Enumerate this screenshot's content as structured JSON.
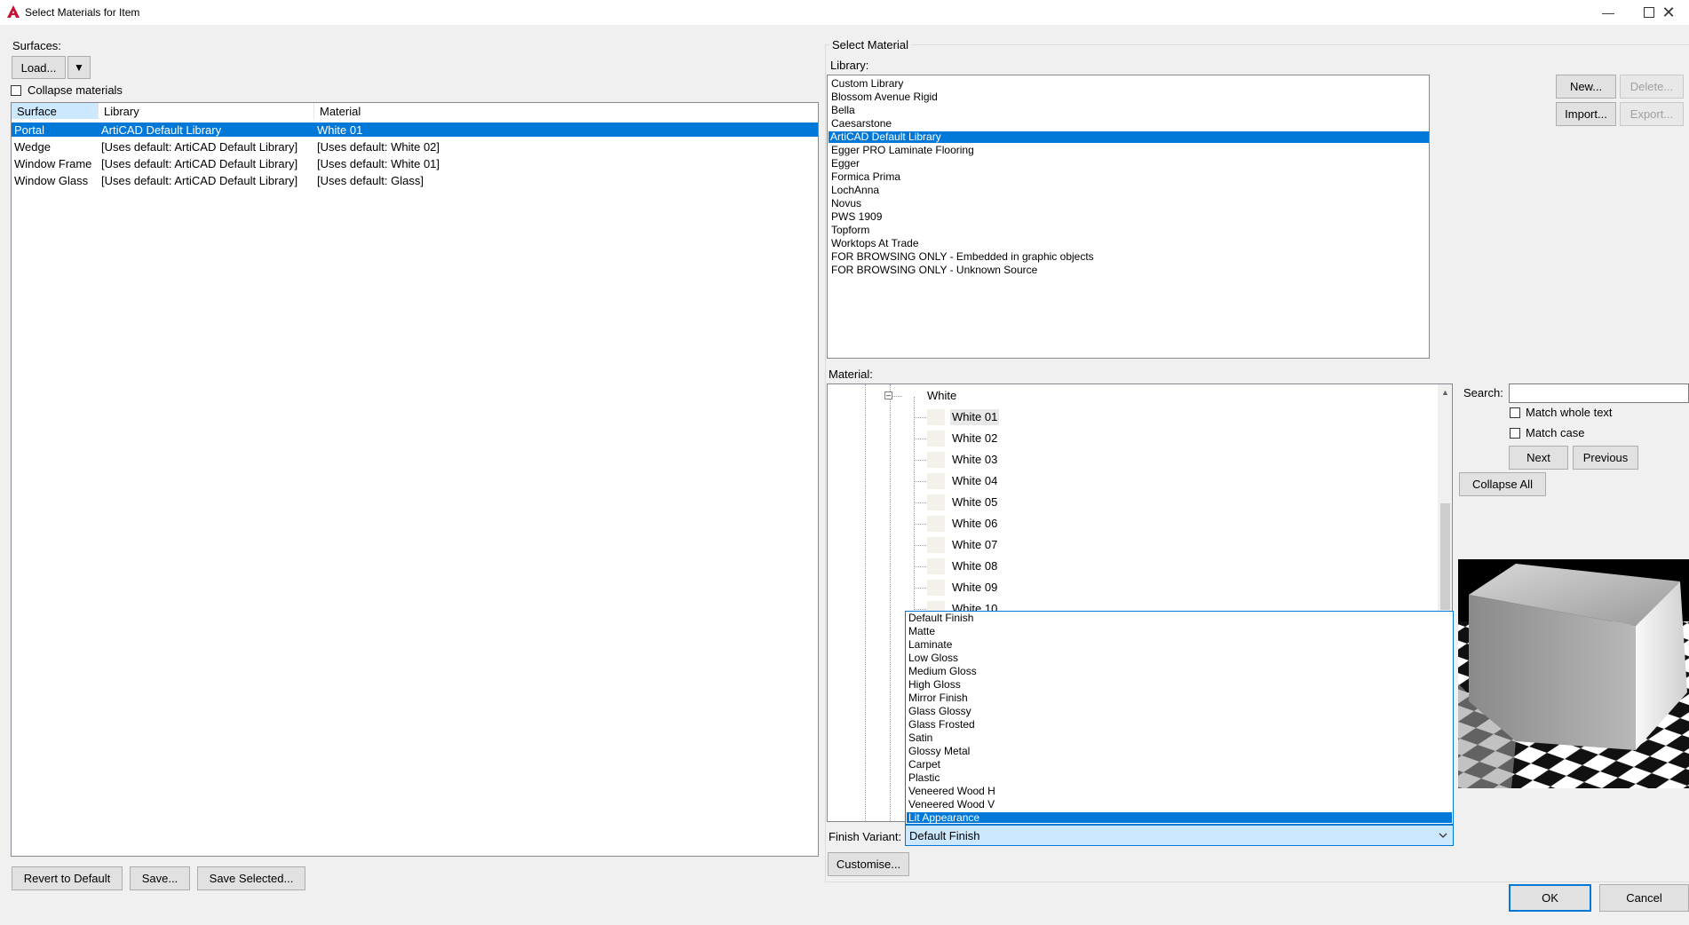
{
  "window": {
    "title": "Select Materials for Item",
    "minimize_icon": "minimize-icon",
    "maximize_icon": "maximize-icon",
    "close_icon": "close-icon"
  },
  "surfaces": {
    "label": "Surfaces:",
    "load_button": "Load...",
    "load_dropdown_glyph": "▼",
    "collapse_label": "Collapse materials",
    "columns": [
      "Surface",
      "Library",
      "Material"
    ],
    "rows": [
      {
        "surface": "Portal",
        "library": "ArtiCAD Default Library",
        "material": "White 01",
        "selected": true
      },
      {
        "surface": "Wedge",
        "library": "[Uses default: ArtiCAD Default Library]",
        "material": "[Uses default: White 02]",
        "selected": false
      },
      {
        "surface": "Window Frame",
        "library": "[Uses default: ArtiCAD Default Library]",
        "material": "[Uses default: White 01]",
        "selected": false
      },
      {
        "surface": "Window Glass",
        "library": "[Uses default: ArtiCAD Default Library]",
        "material": "[Uses default: Glass]",
        "selected": false
      }
    ],
    "revert_button": "Revert to Default",
    "save_button": "Save...",
    "save_selected_button": "Save Selected..."
  },
  "select_material": {
    "group_label": "Select Material",
    "library_label": "Library:",
    "libraries": [
      "Custom Library",
      "Blossom Avenue Rigid",
      "Bella",
      "Caesarstone",
      "ArtiCAD Default Library",
      "Egger PRO Laminate Flooring",
      "Egger",
      "Formica Prima",
      "LochAnna",
      "Novus",
      "PWS 1909",
      "Topform",
      "Worktops At Trade",
      "FOR BROWSING ONLY - Embedded in graphic objects",
      "FOR BROWSING ONLY - Unknown Source"
    ],
    "selected_library": "ArtiCAD Default Library",
    "new_button": "New...",
    "delete_button": "Delete...",
    "import_button": "Import...",
    "export_button": "Export...",
    "material_label": "Material:",
    "tree_group": "White",
    "tree_items": [
      "White 01",
      "White 02",
      "White 03",
      "White 04",
      "White 05",
      "White 06",
      "White 07",
      "White 08",
      "White 09",
      "White 10"
    ],
    "search_label": "Search:",
    "search_value": "",
    "match_whole_text": "Match whole text",
    "match_case": "Match case",
    "next_button": "Next",
    "previous_button": "Previous",
    "collapse_all_button": "Collapse All",
    "finish_variant_label": "Finish Variant:",
    "finish_variant_value": "Default Finish",
    "finish_options": [
      "Default Finish",
      "Matte",
      "Laminate",
      "Low Gloss",
      "Medium Gloss",
      "High Gloss",
      "Mirror Finish",
      "Glass Glossy",
      "Glass Frosted",
      "Satin",
      "Glossy Metal",
      "Carpet",
      "Plastic",
      "Veneered Wood H",
      "Veneered Wood V",
      "Lit Appearance"
    ],
    "highlighted_option": "Lit Appearance",
    "customise_button": "Customise..."
  },
  "footer": {
    "ok_button": "OK",
    "cancel_button": "Cancel"
  },
  "colors": {
    "selection": "#0078d7",
    "header_highlight": "#cce8ff"
  }
}
